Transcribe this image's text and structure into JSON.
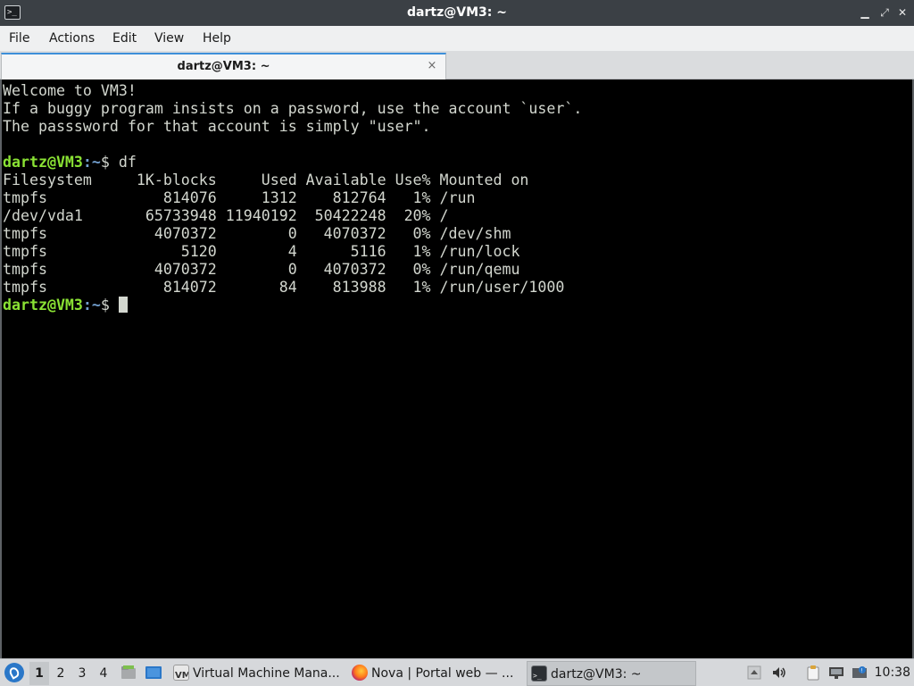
{
  "window": {
    "title": "dartz@VM3: ~",
    "controls": [
      "minimize-icon",
      "restore-icon",
      "close-icon"
    ]
  },
  "menu": {
    "items": [
      "File",
      "Actions",
      "Edit",
      "View",
      "Help"
    ]
  },
  "tab": {
    "label": "dartz@VM3: ~",
    "close_glyph": "×"
  },
  "terminal": {
    "motd": [
      "Welcome to VM3!",
      "If a buggy program insists on a password, use the account `user`.",
      "The passsword for that account is simply \"user\"."
    ],
    "prompt_user": "dartz@VM3",
    "prompt_path": ":~",
    "prompt_symbol": "$ ",
    "command": "df",
    "df_output": [
      "Filesystem     1K-blocks     Used Available Use% Mounted on",
      "tmpfs             814076     1312    812764   1% /run",
      "/dev/vda1       65733948 11940192  50422248  20% /",
      "tmpfs            4070372        0   4070372   0% /dev/shm",
      "tmpfs               5120        4      5116   1% /run/lock",
      "tmpfs            4070372        0   4070372   0% /run/qemu",
      "tmpfs             814072       84    813988   1% /run/user/1000"
    ]
  },
  "taskbar": {
    "workspaces": [
      "1",
      "2",
      "3",
      "4"
    ],
    "active_workspace": "1",
    "tasks": [
      {
        "label": "Virtual Machine Mana...",
        "icon": "virt-manager-icon"
      },
      {
        "label": "Nova | Portal web — ...",
        "icon": "firefox-icon"
      },
      {
        "label": "dartz@VM3: ~",
        "icon": "terminal-icon"
      }
    ],
    "clock": "10:38"
  },
  "colors": {
    "titlebar": "#3b4045",
    "terminal_bg": "#000000",
    "terminal_fg": "#d3d7cf",
    "prompt_user": "#8ae234",
    "prompt_path": "#729fcf",
    "accent": "#3d8fd9"
  }
}
